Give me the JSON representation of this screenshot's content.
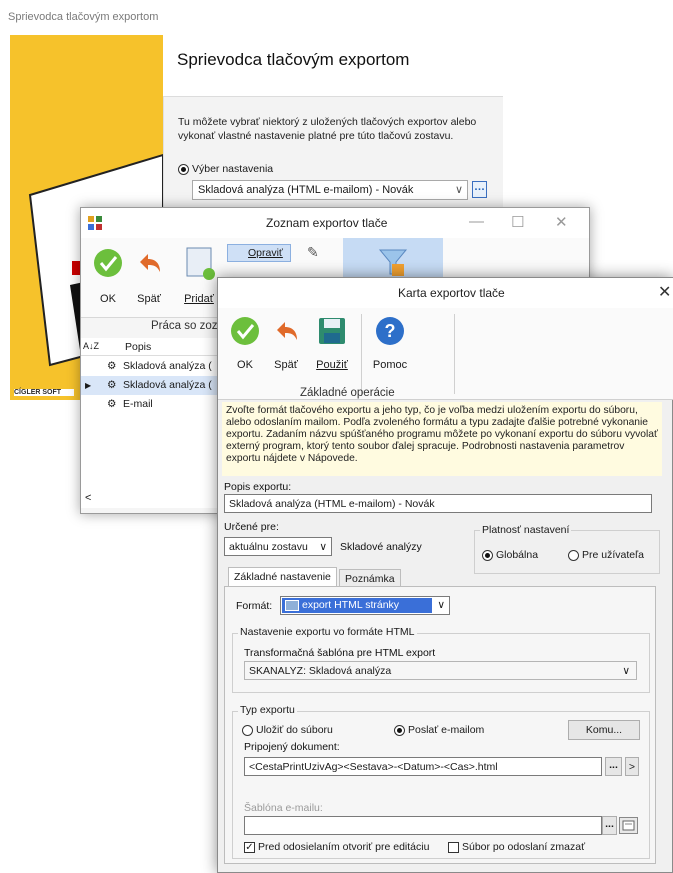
{
  "wizard": {
    "window_title": "Sprievodca tlačovým exportom",
    "heading": "Sprievodca tlačovým exportom",
    "description": "Tu môžete vybrať niektorý z uložených tlačových exportov alebo vykonať vlastné nastavenie platné pre túto tlačovú zostavu.",
    "radio_label": "Výber nastavenia",
    "combo_value": "Skladová analýza  (HTML e-mailom) - Novák",
    "dots_label": "…",
    "left_footer": "CÍGLER SOFT"
  },
  "list_window": {
    "title": "Zoznam exportov tlače",
    "toolbar": {
      "ok": "OK",
      "back": "Späť",
      "add": "Pridať",
      "edit": "Opraviť",
      "group_label": "Práca so zoz"
    },
    "grid": {
      "sort_icon": "A↓Z",
      "column": "Popis",
      "rows": [
        "Skladová analýza  (",
        "Skladová analýza  (",
        "E-mail"
      ]
    }
  },
  "card_window": {
    "title": "Karta exportov tlače",
    "toolbar": {
      "ok": "OK",
      "back": "Späť",
      "apply": "Použiť",
      "help": "Pomoc",
      "group_label": "Základné operácie"
    },
    "info_text": "Zvoľte formát tlačového exportu a jeho typ, čo je voľba medzi uložením exportu do súboru, alebo odoslaním mailom. Podľa zvoleného formátu a typu zadajte ďalšie potrebné vykonanie exportu. Zadaním názvu spúšťaného programu môžete po vykonaní exportu do súboru vyvolať externý program, ktorý tento soubor ďalej spracuje. Podrobnosti nastavenia parametrov exportu nájdete v Nápovede.",
    "popis_label": "Popis exportu:",
    "popis_value": "Skladová analýza  (HTML e-mailom) - Novák",
    "urcene_label": "Určené pre:",
    "urcene_value": "aktuálnu zostavu",
    "urcene_text": "Skladové analýzy",
    "platnost_legend": "Platnosť nastavení",
    "platnost_global": "Globálna",
    "platnost_user": "Pre užívateľa",
    "tabs": [
      "Základné nastavenie",
      "Poznámka"
    ],
    "format_label": "Formát:",
    "format_value": "export HTML stránky",
    "html_group": "Nastavenie exportu vo formáte HTML",
    "sablona_label": "Transformačná šablóna pre HTML export",
    "sablona_value": "SKANALYZ: Skladová analýza",
    "typ_legend": "Typ exportu",
    "typ_ulozit": "Uložiť do súboru",
    "typ_poslat": "Poslať e-mailom",
    "komu_button": "Komu...",
    "pripojeny_label": "Pripojený dokument:",
    "pripojeny_value": "<CestaPrintUzivAg><Sestava>-<Datum>-<Cas>.html",
    "dots": "...",
    "next": ">",
    "sablona_email_label": "Šablóna e-mailu:",
    "check_otvorit": "Pred odosielaním otvoriť pre editáciu",
    "check_zmazat": "Súbor po odoslaní zmazať"
  },
  "colors": {
    "accent_yellow": "#f6c22b",
    "selection_blue": "#3a6fd8",
    "info_bg": "#fffbe0"
  }
}
